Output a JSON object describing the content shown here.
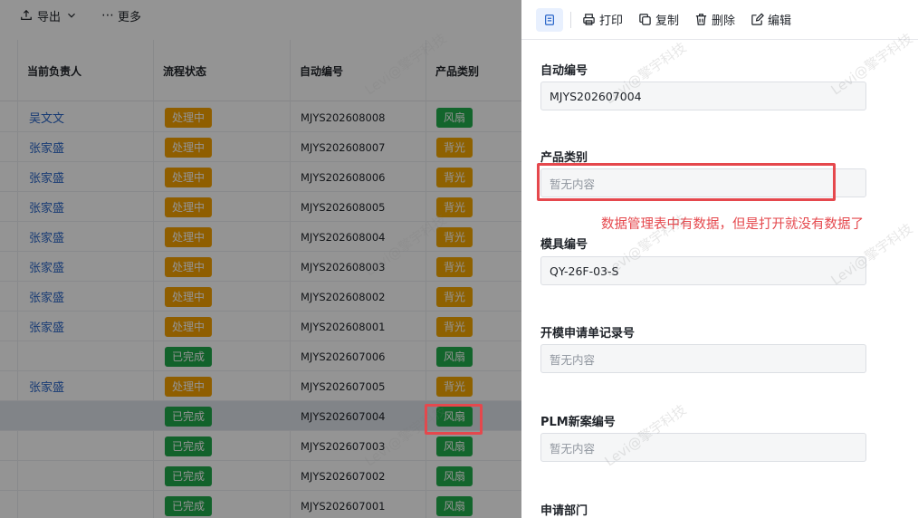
{
  "toolbar": {
    "export_label": "导出",
    "more_label": "更多"
  },
  "table": {
    "headers": {
      "owner": "当前负责人",
      "status": "流程状态",
      "code": "自动编号",
      "category": "产品类别"
    },
    "rows": [
      {
        "owner": "吴文文",
        "status": "处理中",
        "status_color": "orange",
        "code": "MJYS202608008",
        "category": "风扇",
        "category_color": "green"
      },
      {
        "owner": "张家盛",
        "status": "处理中",
        "status_color": "orange",
        "code": "MJYS202608007",
        "category": "背光",
        "category_color": "orange"
      },
      {
        "owner": "张家盛",
        "status": "处理中",
        "status_color": "orange",
        "code": "MJYS202608006",
        "category": "背光",
        "category_color": "orange"
      },
      {
        "owner": "张家盛",
        "status": "处理中",
        "status_color": "orange",
        "code": "MJYS202608005",
        "category": "背光",
        "category_color": "orange"
      },
      {
        "owner": "张家盛",
        "status": "处理中",
        "status_color": "orange",
        "code": "MJYS202608004",
        "category": "背光",
        "category_color": "orange"
      },
      {
        "owner": "张家盛",
        "status": "处理中",
        "status_color": "orange",
        "code": "MJYS202608003",
        "category": "背光",
        "category_color": "orange"
      },
      {
        "owner": "张家盛",
        "status": "处理中",
        "status_color": "orange",
        "code": "MJYS202608002",
        "category": "背光",
        "category_color": "orange"
      },
      {
        "owner": "张家盛",
        "status": "处理中",
        "status_color": "orange",
        "code": "MJYS202608001",
        "category": "背光",
        "category_color": "orange"
      },
      {
        "owner": "",
        "status": "已完成",
        "status_color": "green",
        "code": "MJYS202607006",
        "category": "风扇",
        "category_color": "green"
      },
      {
        "owner": "张家盛",
        "status": "处理中",
        "status_color": "orange",
        "code": "MJYS202607005",
        "category": "背光",
        "category_color": "orange"
      },
      {
        "owner": "",
        "status": "已完成",
        "status_color": "green",
        "code": "MJYS202607004",
        "category": "风扇",
        "category_color": "green",
        "selected": true
      },
      {
        "owner": "",
        "status": "已完成",
        "status_color": "green",
        "code": "MJYS202607003",
        "category": "风扇",
        "category_color": "green"
      },
      {
        "owner": "",
        "status": "已完成",
        "status_color": "green",
        "code": "MJYS202607002",
        "category": "风扇",
        "category_color": "green"
      },
      {
        "owner": "",
        "status": "已完成",
        "status_color": "green",
        "code": "MJYS202607001",
        "category": "风扇",
        "category_color": "green"
      }
    ]
  },
  "drawer": {
    "actions": {
      "print": "打印",
      "copy": "复制",
      "delete": "删除",
      "edit": "编辑"
    },
    "fields": [
      {
        "label": "自动编号",
        "value": "MJYS202607004",
        "empty": false
      },
      {
        "label": "产品类别",
        "value": "暂无内容",
        "empty": true
      },
      {
        "label": "模具编号",
        "value": "QY-26F-03-S",
        "empty": false
      },
      {
        "label": "开模申请单记录号",
        "value": "暂无内容",
        "empty": true
      },
      {
        "label": "PLM新案编号",
        "value": "暂无内容",
        "empty": true
      },
      {
        "label": "申请部门",
        "value": "",
        "empty": true
      }
    ],
    "annotation": "数据管理表中有数据，但是打开就没有数据了"
  },
  "watermark": "Levi@擎宇科技",
  "colors": {
    "accent": "#2a66c9",
    "processing": "#f6a300",
    "done": "#1fa94a",
    "highlight": "#e5484d"
  }
}
